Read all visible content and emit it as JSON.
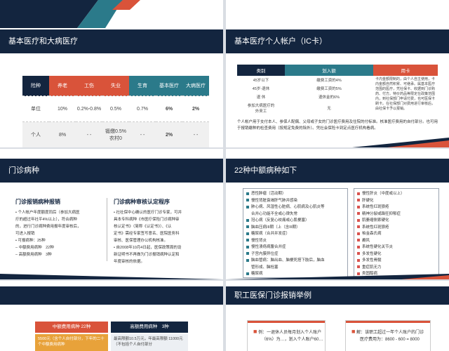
{
  "slides": {
    "top_left": {
      "title": "基本医疗和大病医疗",
      "table": {
        "headers": [
          "险种",
          "养老",
          "工伤",
          "失业",
          "生育",
          "基本医疗",
          "大病医疗"
        ],
        "header_colors": [
          "#d9533a",
          "#d9533a",
          "#d9533a",
          "#d9533a",
          "#2b7a8a",
          "#2b7a8a",
          "#2b7a8a"
        ],
        "rows": [
          {
            "label": "单位",
            "cells": [
              "10%",
              "0.2%-0.8%",
              "0.5%",
              "0.7%",
              "6%",
              "2%"
            ]
          },
          {
            "label": "个人",
            "cells": [
              "8%",
              "- -",
              "锻缴0.5%\n农村0",
              "- -",
              "2%",
              "- -"
            ]
          }
        ]
      }
    },
    "top_right": {
      "title": "基本医疗个人帐户（IC卡）",
      "table": {
        "headers": [
          "类别",
          "划入额",
          "用卡"
        ],
        "rows": [
          [
            "45岁以下",
            "缴费工资的4%",
            ""
          ],
          [
            "45岁-退休",
            "缴费工资的5%",
            ""
          ],
          [
            "退 休",
            "退休金的6%",
            ""
          ],
          [
            "参加大病医疗的\n外来工",
            "无",
            ""
          ]
        ],
        "card_note": "卡内金额限制的，由个人自主使用，卡内金额自然积累、可继承。属基本医疗范围的医疗，凭社保卡、收据到门诊购药、付方。特价药品等限定在政策范围内，到社保部门申请付费，也可医保卡刷卡。在社保部门对费用进行审核后，由社保卡予以报销。"
      },
      "paragraph": "个人帐户用于支付本人、参保人配偶、父母或子女的门诊医疗费用及住院的付标准。核准医疗费用的自付部分。也可用于报销缴种的检查费用（按规定免费的除外）。凭社会保险卡到定点医疗机构看病。"
    },
    "mid_left": {
      "title": "门诊病种",
      "col1_title": "门诊报销病种报销",
      "col1_items": [
        "• 个人帐户年度额度同后（参加大病医",
        "  疗的超过年社平4%以上），符合病种",
        "  的，进行门诊病种费用报年度审核后，",
        "  可进入报销",
        "• 可报病种：25种",
        "    – 中额费用病种　22种",
        "    – 高额费用病种　3种"
      ],
      "col2_title": "门诊病种审核认定程序",
      "col2_items": [
        "• 社社保中心确认的医疗门诊专家，可并",
        "  具本专科病种《市医疗保险门诊病种审",
        "  核认定书》（简称《认定书》）、《认",
        "  定书》需经专家签写意名、医院医务科",
        "  审核、医保管理办公机构核准。",
        "• 自2008年10月4日起，医保政策周的设",
        "  新证明书不再做为门诊报销病种认定和",
        "  年度审核的依据。"
      ]
    },
    "mid_right": {
      "title": "22种中额病种如下",
      "left_list": [
        "恶性肿瘤（活动期）",
        "慢性肾脏衰竭肝气肺并感染",
        "肺心病、风湿性心脏病、心肌病及心肌炎等",
        "合并心功能不全或心律失常",
        "冠心病（反复心绞痛或心肌梗塞）",
        "脑血压病III期（上（含III期）",
        "糖尿病（合并并发症）",
        "慢性肾炎",
        "慢性溃疡病腹合并症",
        "子宫内膜异位症",
        "脑血管病：脑出血、脑梗死搭下肢后，脑血",
        "管形成、脑栓塞",
        "糖尿病"
      ],
      "right_list": [
        "慢性肝炎（中度或以上）",
        "肝硬化",
        "系统性红斑狼疮",
        "精神分裂或躁狂抑郁症",
        "肌萎缩侧索硬化",
        "系统性红斑狼疮",
        "帕金森氏病",
        "癫风",
        "系统性硬化关节炎",
        "多发性硬化",
        "多发性骨髓",
        "重症肌无力",
        "类固醇病"
      ]
    },
    "bottom_left": {
      "box1_title": "中额费用病种 22种",
      "box1_text": "5500元（含个人自付部分，下年的二十个中额费用病种",
      "box2_title": "高额费用病种　3种",
      "box2_text": "最高限额10.5万元，年最高限额 11000元（不包括个人自付部分"
    },
    "bottom_right": {
      "title": "职工医保门诊报销举例",
      "example1": "例：一退休人员每月划入个人账户",
      "example1b": "（6%）为…，划入个人账户60…",
      "example2": "解：该职工超过一年个人账户的门诊",
      "example2b": "医疗费用为：8600 - 600 = 8000"
    }
  },
  "colors": {
    "navy": "#13253f",
    "orange": "#d9533a",
    "teal": "#2b7a8a",
    "red": "#c8442e"
  }
}
